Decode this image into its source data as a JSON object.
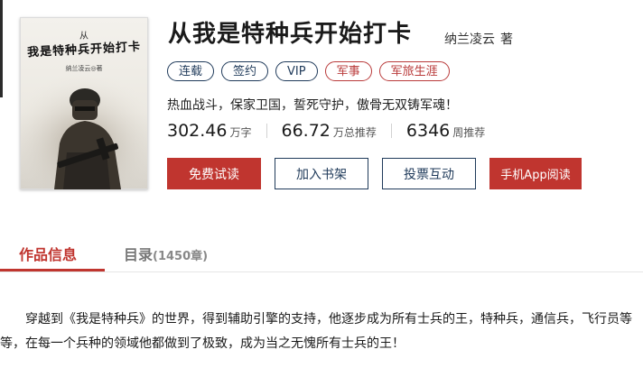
{
  "cover": {
    "small_text": "从",
    "title": "我是特种兵开始打卡",
    "author": "纳兰凌云◎著"
  },
  "book": {
    "title": "从我是特种兵开始打卡",
    "author": "纳兰凌云",
    "author_suffix": "著",
    "tags": [
      "连载",
      "签约",
      "VIP",
      "军事",
      "军旅生涯"
    ],
    "tagline": "热血战斗，保家卫国，誓死守护，傲骨无双铸军魂！",
    "stats": [
      {
        "value": "302.46",
        "unit": "万字"
      },
      {
        "value": "66.72",
        "unit": "万总推荐"
      },
      {
        "value": "6346",
        "unit": "周推荐"
      }
    ]
  },
  "buttons": {
    "free_read": "免费试读",
    "add_shelf": "加入书架",
    "vote": "投票互动",
    "app_read": "手机App阅读"
  },
  "tabs": {
    "info": "作品信息",
    "toc": "目录",
    "toc_count": "(1450章)"
  },
  "description": {
    "line1": "穿越到《我是特种兵》的世界，得到辅助引擎的支持，他逐步成为所有士兵的王，特种兵，通信兵，飞行员等",
    "line2": "等，在每一个兵种的领域他都做到了极致，成为当之无愧所有士兵的王！"
  },
  "colors": {
    "accent_red": "#c0352f",
    "navy": "#1f3a5a"
  }
}
